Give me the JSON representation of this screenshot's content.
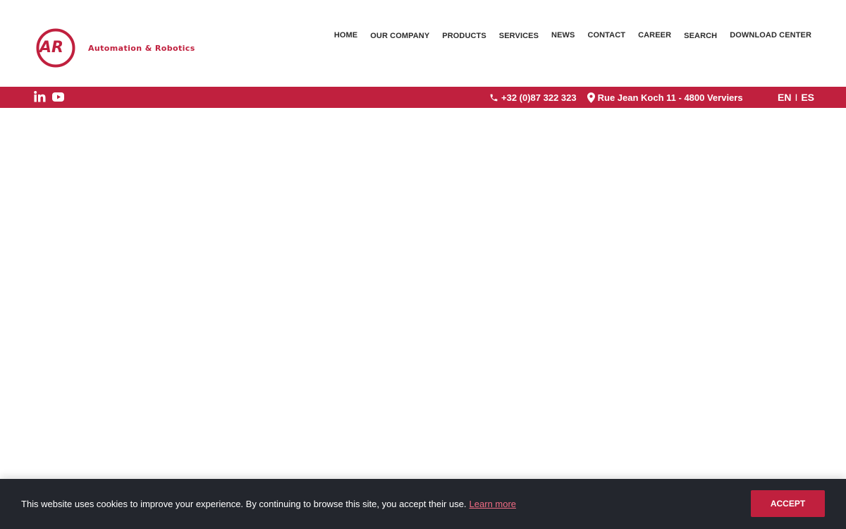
{
  "brand": {
    "logo_mark": "AR",
    "tagline": "Automation & Robotics",
    "accent_color": "#c0203e"
  },
  "nav": {
    "items": [
      "HOME",
      "OUR COMPANY",
      "PRODUCTS",
      "SERVICES",
      "NEWS",
      "CONTACT",
      "CAREER",
      "SEARCH",
      "DOWNLOAD CENTER"
    ]
  },
  "topbar": {
    "social_icons": [
      "linkedin-icon",
      "youtube-icon"
    ],
    "phone": "+32 (0)87 322 323",
    "address": "Rue Jean Koch 11 - 4800 Verviers",
    "lang_en": "EN",
    "lang_sep": "I",
    "lang_es": "ES"
  },
  "cookie": {
    "message": "This website uses cookies to improve your experience. By continuing to browse this site, you accept their use.",
    "learn_more": "Learn more",
    "accept": "ACCEPT",
    "background_color": "#23262d"
  }
}
